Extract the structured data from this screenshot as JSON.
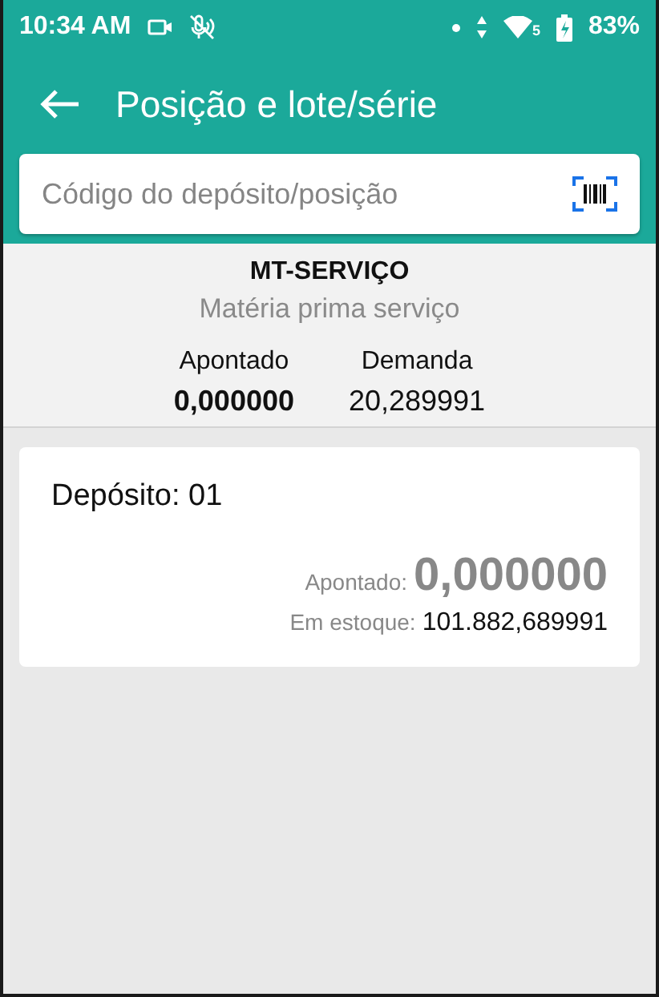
{
  "status_bar": {
    "time": "10:34 AM",
    "network_badge": "5",
    "battery": "83%"
  },
  "app_bar": {
    "title": "Posição e lote/série"
  },
  "search": {
    "placeholder": "Código do depósito/posição"
  },
  "product": {
    "code": "MT-SERVIÇO",
    "name": "Matéria prima serviço",
    "stats": [
      {
        "label": "Apontado",
        "value": "0,000000",
        "bold": true
      },
      {
        "label": "Demanda",
        "value": "20,289991",
        "bold": false
      }
    ]
  },
  "deposits": [
    {
      "title": "Depósito: 01",
      "apontado_label": "Apontado:",
      "apontado_value": "0,000000",
      "stock_label": "Em estoque:",
      "stock_value": "101.882,689991"
    }
  ]
}
